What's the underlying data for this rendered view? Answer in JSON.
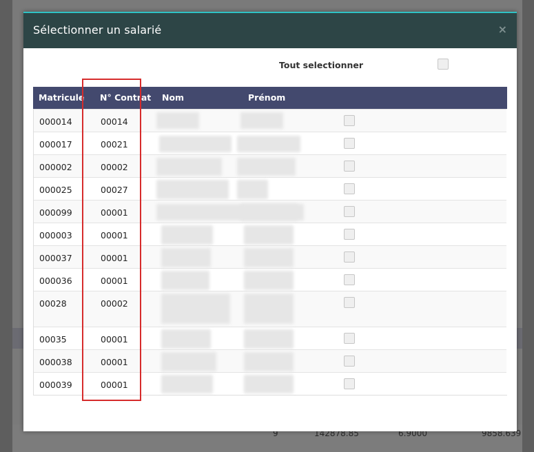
{
  "background": {
    "footer_values": [
      "9",
      "142878.85",
      "6.9000",
      "9858.639"
    ]
  },
  "modal": {
    "title": "Sélectionner un salarié",
    "close_icon": "×",
    "select_all_label": "Tout selectionner",
    "accent_color": "#2fc3c5",
    "header_color": "#2d4546",
    "table_header_color": "#43496e"
  },
  "table": {
    "columns": [
      "Matricule",
      "N° Contrat",
      "Nom",
      "Prénom"
    ],
    "rows": [
      {
        "matricule": "000014",
        "contrat": "00014"
      },
      {
        "matricule": "000017",
        "contrat": "00021"
      },
      {
        "matricule": "000002",
        "contrat": "00002"
      },
      {
        "matricule": "000025",
        "contrat": "00027"
      },
      {
        "matricule": "000099",
        "contrat": "00001"
      },
      {
        "matricule": "000003",
        "contrat": "00001"
      },
      {
        "matricule": "000037",
        "contrat": "00001"
      },
      {
        "matricule": "000036",
        "contrat": "00001"
      },
      {
        "matricule": "00028",
        "contrat": "00002"
      },
      {
        "matricule": "00035",
        "contrat": "00001"
      },
      {
        "matricule": "000038",
        "contrat": "00001"
      },
      {
        "matricule": "000039",
        "contrat": "00001"
      }
    ]
  },
  "annotation": {
    "highlight_color": "#d62b2b"
  }
}
